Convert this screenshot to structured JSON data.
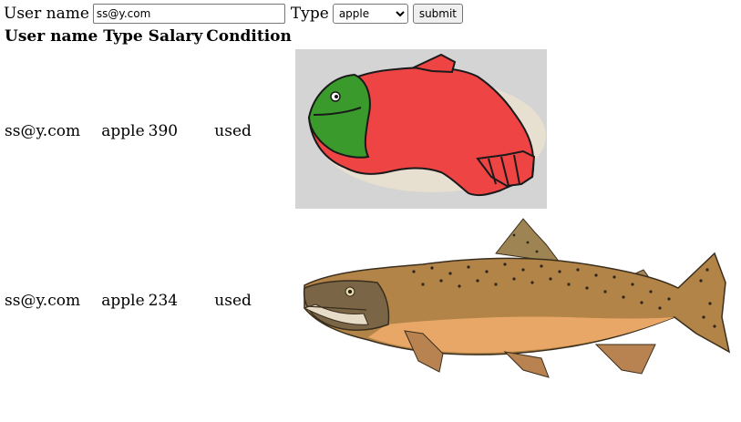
{
  "form": {
    "username_label": "User name",
    "username_value": "ss@y.com",
    "type_label": "Type",
    "type_selected": "apple",
    "submit_label": "submit"
  },
  "table": {
    "headers": [
      "User name",
      "Type",
      "Salary",
      "Condition"
    ],
    "rows": [
      {
        "user": "ss@y.com",
        "type": "apple",
        "salary": "390",
        "condition": "used",
        "image": "salmon-cookie-image"
      },
      {
        "user": "ss@y.com",
        "type": "apple",
        "salary": "234",
        "condition": "used",
        "image": "salmon-fish-image"
      }
    ]
  },
  "colors": {
    "cookie_red": "#ee4444",
    "cookie_green": "#3a9a2c",
    "fish_body": "#b38447",
    "fish_belly": "#e8a766",
    "fish_spots": "#2d241a"
  }
}
